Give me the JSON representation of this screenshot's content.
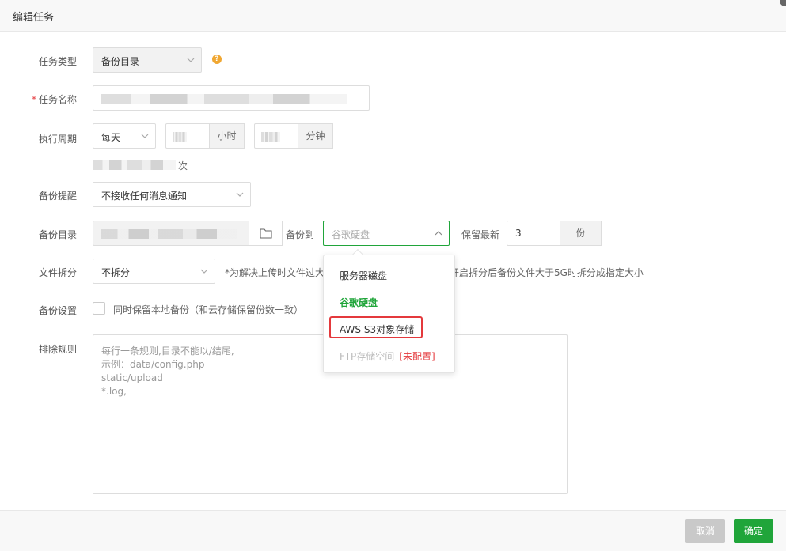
{
  "dialog": {
    "title": "编辑任务"
  },
  "form": {
    "task_type": {
      "label": "任务类型",
      "value": "备份目录"
    },
    "task_name": {
      "label": "任务名称",
      "required_mark": "*"
    },
    "schedule": {
      "label": "执行周期",
      "value": "每天",
      "hour_unit": "小时",
      "minute_unit": "分钟",
      "summary_suffix": "次"
    },
    "notify": {
      "label": "备份提醒",
      "value": "不接收任何消息通知"
    },
    "backup_dir": {
      "label": "备份目录",
      "backup_to_label": "备份到",
      "backup_to_value": "谷歌硬盘",
      "keep_label": "保留最新",
      "keep_value": "3",
      "keep_unit": "份"
    },
    "split": {
      "label": "文件拆分",
      "value": "不拆分",
      "note_left": "*为解决上传时文件过大",
      "note_right": "开启拆分后备份文件大于5G时拆分成指定大小"
    },
    "settings": {
      "label": "备份设置",
      "checkbox_text": "同时保留本地备份（和云存储保留份数一致）"
    },
    "exclude": {
      "label": "排除规则",
      "placeholder": "每行一条规则,目录不能以/结尾,\n示例：data/config.php\nstatic/upload\n*.log,"
    }
  },
  "dropdown": {
    "options": [
      {
        "label": "服务器磁盘",
        "state": "normal"
      },
      {
        "label": "谷歌硬盘",
        "state": "selected"
      },
      {
        "label": "AWS S3对象存储",
        "state": "highlighted"
      },
      {
        "label": "FTP存储空间",
        "state": "disabled",
        "tag": "[未配置]"
      }
    ]
  },
  "footer": {
    "cancel_label": "取消",
    "ok_label": "确定"
  },
  "colors": {
    "accent": "#20a53a",
    "danger": "#e4393c",
    "help": "#f0a732"
  }
}
